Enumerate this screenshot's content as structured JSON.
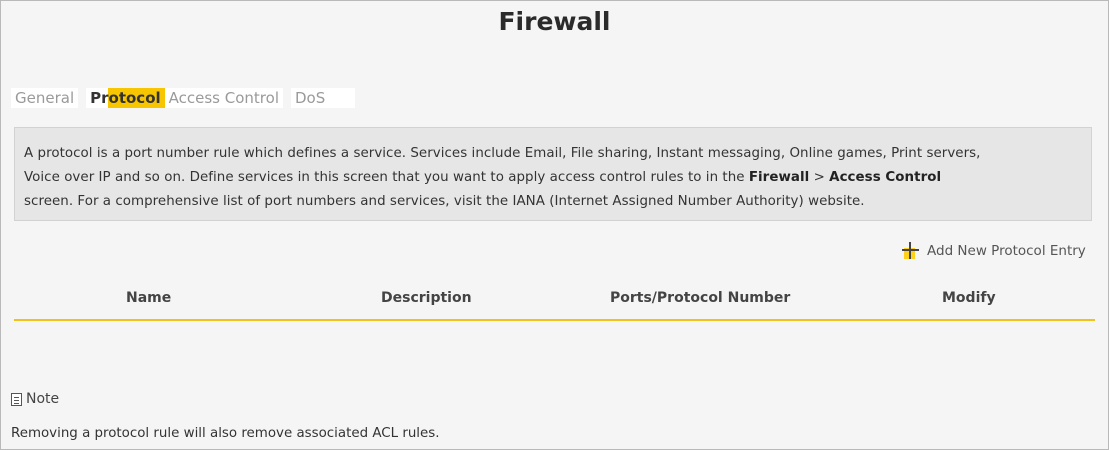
{
  "page": {
    "title": "Firewall"
  },
  "tabs": [
    {
      "label": "General",
      "active": false
    },
    {
      "label": "Protocol",
      "active": true
    },
    {
      "label": "Access Control",
      "active": false
    },
    {
      "label": "DoS",
      "active": false
    }
  ],
  "info": {
    "line1": "A protocol is a port number rule which defines a service. Services include Email, File sharing, Instant messaging, Online games, Print servers,",
    "line2_pre": "Voice over IP and so on. Define services in this screen that you want to apply access control rules to in the ",
    "link_firewall": "Firewall",
    "separator": " > ",
    "link_access_control": "Access Control",
    "line3": "screen. For a comprehensive list of port numbers and services, visit the IANA (Internet Assigned Number Authority) website."
  },
  "actions": {
    "add_label": "Add New Protocol Entry",
    "add_icon": "plus-icon"
  },
  "table": {
    "columns": [
      "Name",
      "Description",
      "Ports/Protocol Number",
      "Modify"
    ],
    "rows": []
  },
  "note": {
    "heading": "Note",
    "icon": "document-icon",
    "text": "Removing a protocol rule will also remove associated ACL rules."
  },
  "colors": {
    "accent": "#f7c600",
    "info_bg": "#e6e6e6",
    "page_bg": "#f5f5f5"
  }
}
